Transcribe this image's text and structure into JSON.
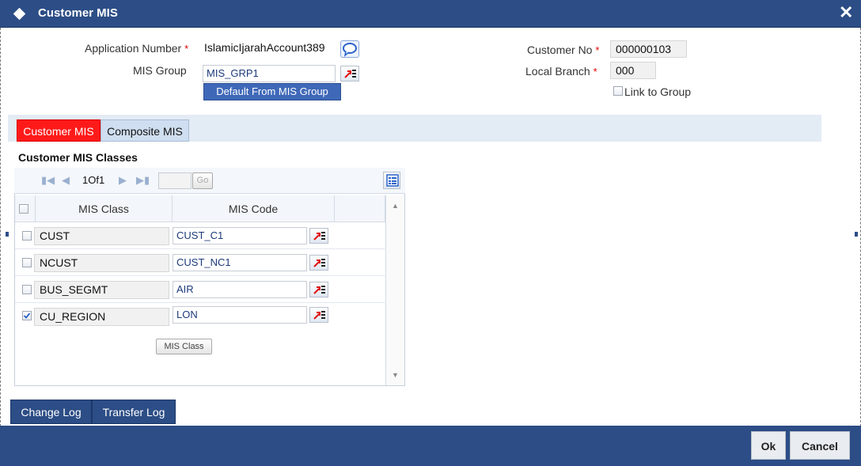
{
  "window": {
    "title": "Customer MIS",
    "close_symbol": "✕"
  },
  "form": {
    "app_number_label": "Application Number",
    "app_number_value": "IslamicIjarahAccount389",
    "mis_group_label": "MIS Group",
    "mis_group_value": "MIS_GRP1",
    "default_button": "Default From MIS Group",
    "customer_no_label": "Customer No",
    "customer_no_value": "000000103",
    "local_branch_label": "Local Branch",
    "local_branch_value": "000",
    "link_group_label": "Link to Group",
    "required_marker": "*"
  },
  "tabs": [
    {
      "label": "Customer MIS",
      "active": true
    },
    {
      "label": "Composite MIS",
      "active": false
    }
  ],
  "section_title": "Customer MIS Classes",
  "pager": {
    "page_text": "1Of1",
    "go_label": "Go"
  },
  "table": {
    "columns": [
      "MIS Class",
      "MIS Code"
    ],
    "rows": [
      {
        "mis_class": "CUST",
        "mis_code": "CUST_C1",
        "checked": false
      },
      {
        "mis_class": "NCUST",
        "mis_code": "CUST_NC1",
        "checked": false
      },
      {
        "mis_class": "BUS_SEGMT",
        "mis_code": "AIR",
        "checked": false
      },
      {
        "mis_class": "CU_REGION",
        "mis_code": "LON",
        "checked": true
      }
    ],
    "mis_class_button": "MIS Class"
  },
  "bottom_tabs": [
    "Change Log",
    "Transfer Log"
  ],
  "footer": {
    "ok": "Ok",
    "cancel": "Cancel"
  },
  "colors": {
    "titlebar": "#2c4d86",
    "active_tab": "#ff0000",
    "inactive_tab": "#cfdef0"
  },
  "icons": [
    "diamond-icon",
    "close-icon",
    "chat-icon",
    "lov-icon",
    "first-page-icon",
    "prev-page-icon",
    "next-page-icon",
    "last-page-icon",
    "grid-settings-icon",
    "scroll-up-icon",
    "scroll-down-icon"
  ]
}
